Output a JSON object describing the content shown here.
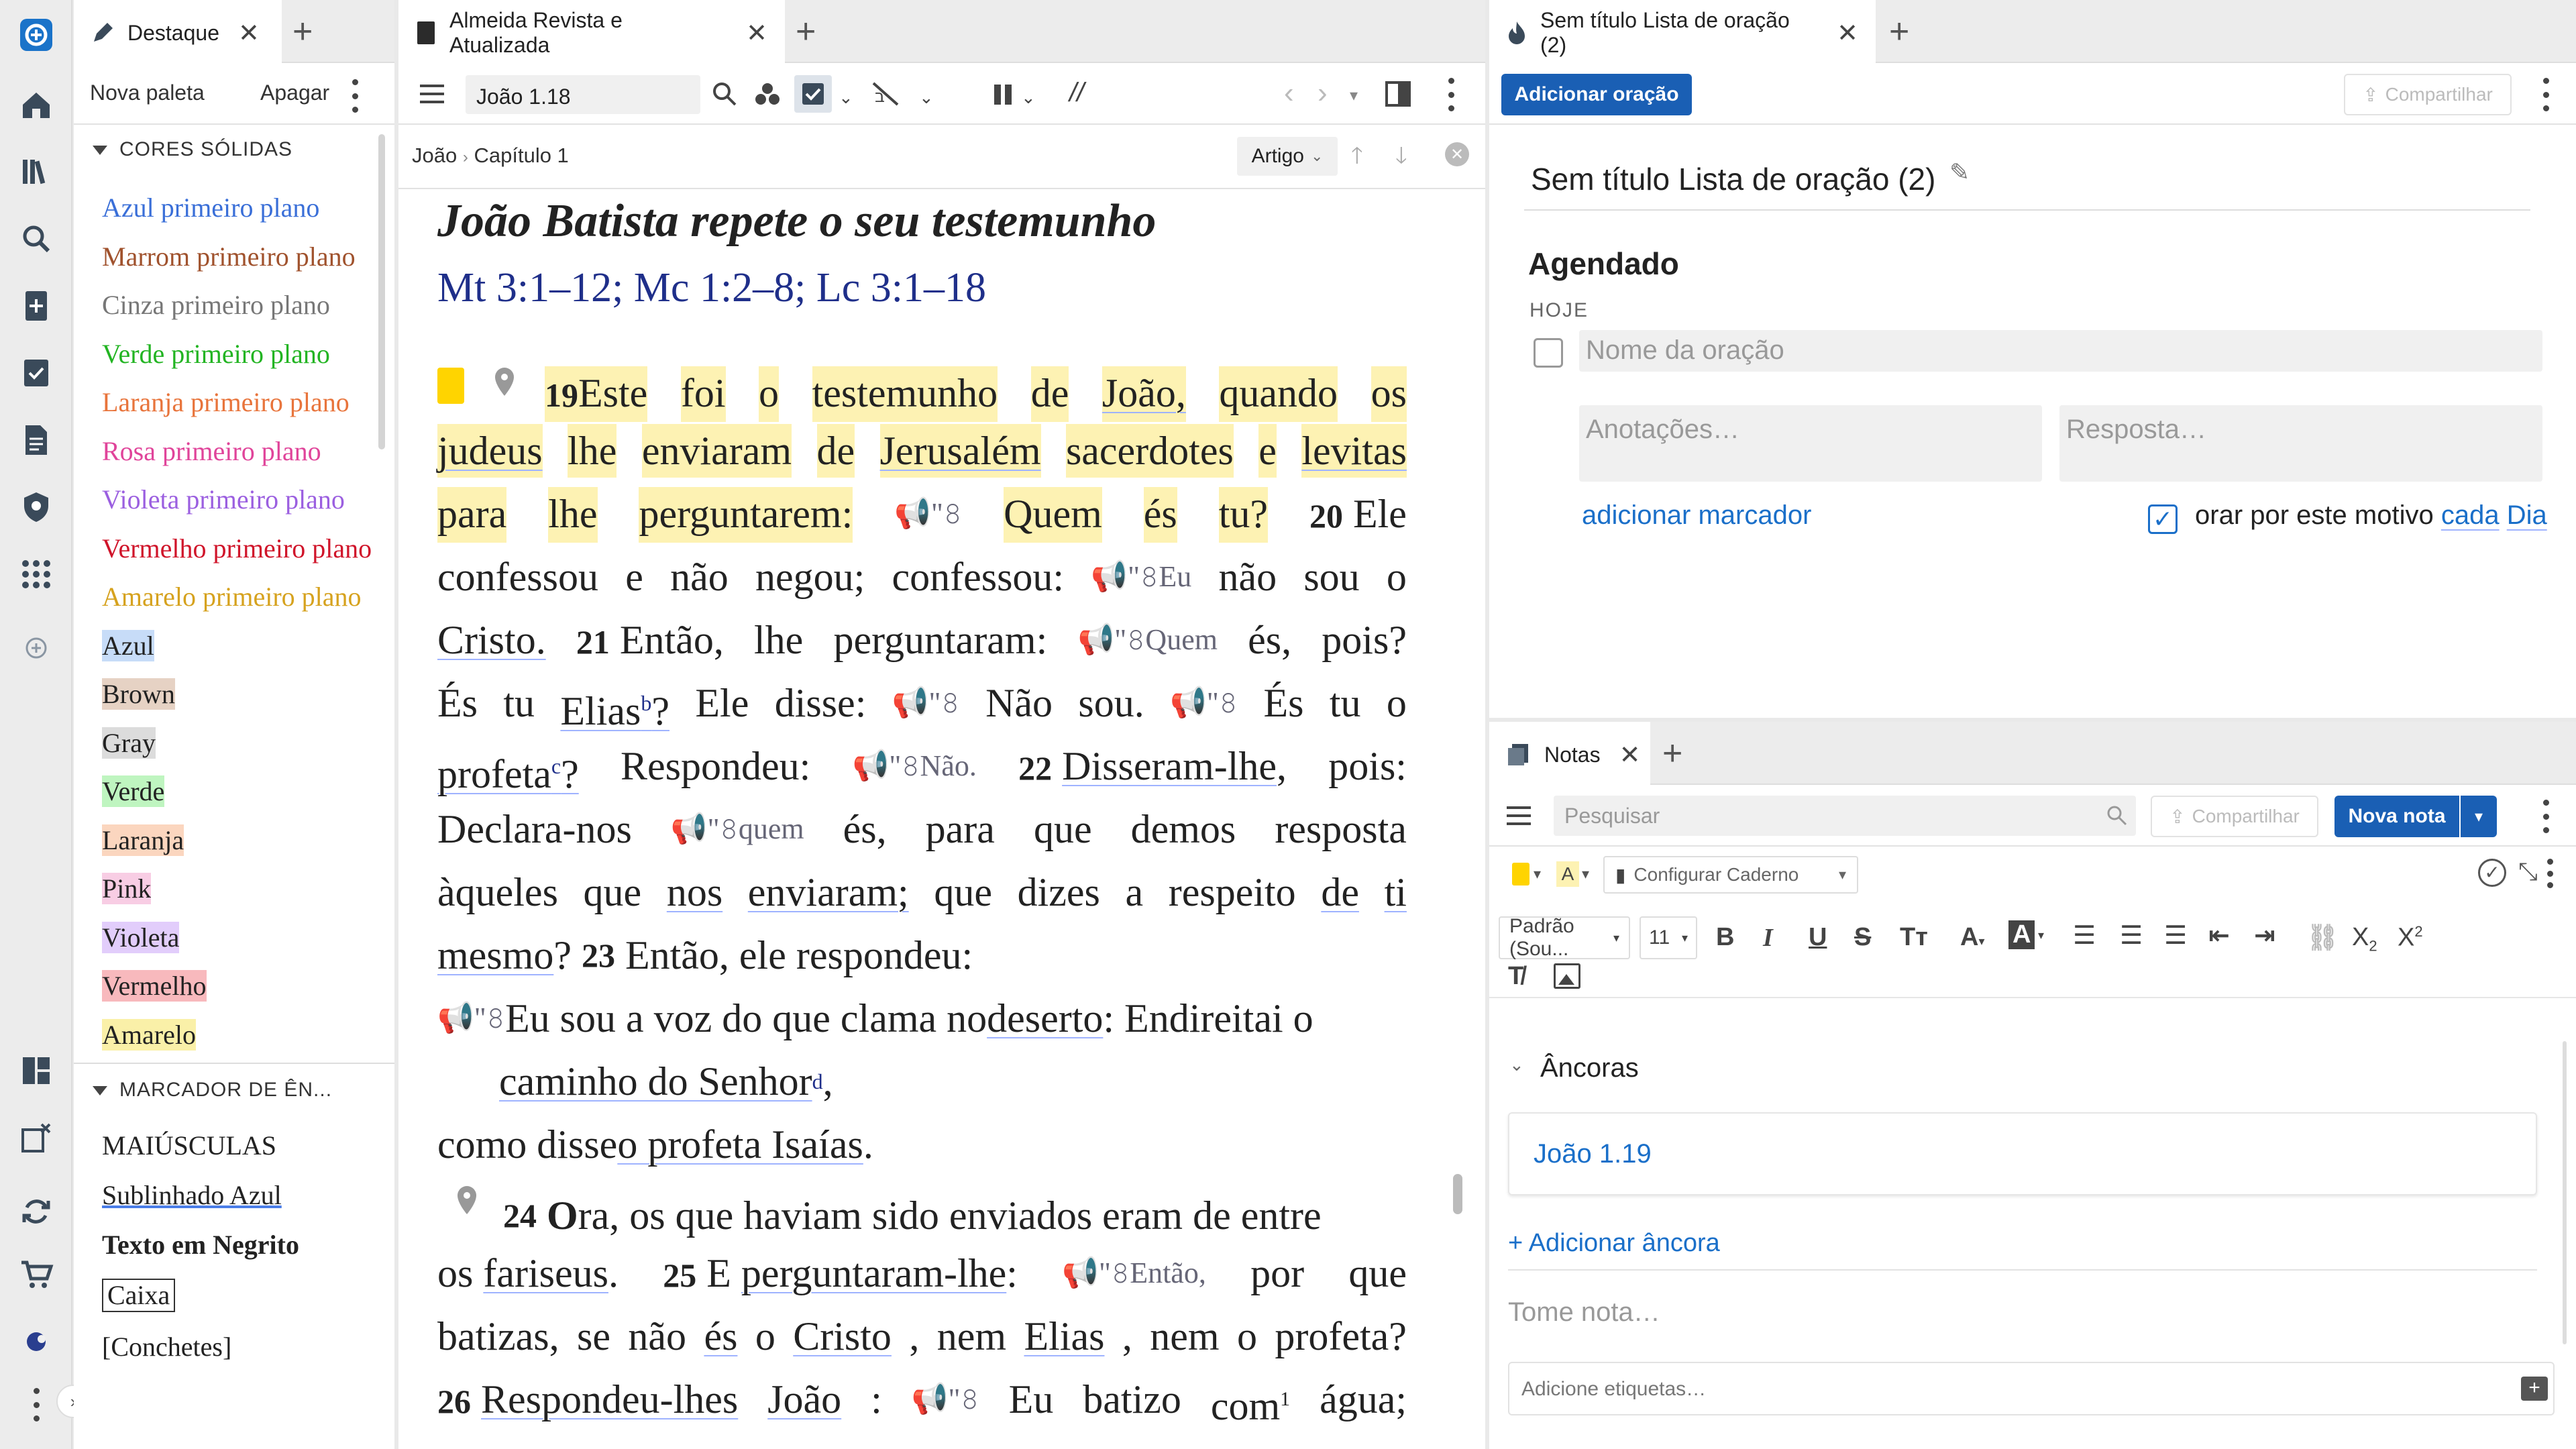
{
  "colors": {
    "accent": "#1a5fb4",
    "link": "#1a6fc9",
    "highlight": "#fdf2b3"
  },
  "rail": {
    "icons": [
      "logo-icon",
      "home-icon",
      "library-icon",
      "search-icon",
      "add-document-icon",
      "checklist-icon",
      "document-icon",
      "shield-icon",
      "apps-grid-icon",
      "add-circle-icon",
      "layout-icon",
      "windows-icon",
      "sync-icon",
      "cart-icon",
      "portfolio-icon",
      "more-icon",
      "expand-icon"
    ]
  },
  "left": {
    "tab_title": "Destaque",
    "new_palette": "Nova paleta",
    "delete": "Apagar",
    "solid_section": "CORES SÓLIDAS",
    "solid_items": [
      {
        "label": "Azul primeiro plano",
        "color": "#3a6fd8",
        "bg": ""
      },
      {
        "label": "Marrom primeiro plano",
        "color": "#a0522d",
        "bg": ""
      },
      {
        "label": "Cinza primeiro plano",
        "color": "#777777",
        "bg": ""
      },
      {
        "label": "Verde primeiro plano",
        "color": "#22b422",
        "bg": ""
      },
      {
        "label": "Laranja primeiro plano",
        "color": "#e8743b",
        "bg": ""
      },
      {
        "label": "Rosa primeiro plano",
        "color": "#e0449a",
        "bg": ""
      },
      {
        "label": "Violeta primeiro plano",
        "color": "#9b5fe0",
        "bg": ""
      },
      {
        "label": "Vermelho primeiro plano",
        "color": "#d0142a",
        "bg": ""
      },
      {
        "label": "Amarelo primeiro plano",
        "color": "#d6a21e",
        "bg": ""
      },
      {
        "label": "Azul",
        "color": "#222",
        "bg": "#c7dcf8"
      },
      {
        "label": "Brown",
        "color": "#222",
        "bg": "#e6d2c4"
      },
      {
        "label": "Gray",
        "color": "#222",
        "bg": "#dcdcdc"
      },
      {
        "label": "Verde",
        "color": "#222",
        "bg": "#bff5c0"
      },
      {
        "label": "Laranja",
        "color": "#222",
        "bg": "#fbd6bf"
      },
      {
        "label": "Pink",
        "color": "#222",
        "bg": "#f8cde4"
      },
      {
        "label": "Violeta",
        "color": "#222",
        "bg": "#e2cdfb"
      },
      {
        "label": "Vermelho",
        "color": "#222",
        "bg": "#f8b9bd"
      },
      {
        "label": "Amarelo",
        "color": "#222",
        "bg": "#faf0a8"
      }
    ],
    "marker_section": "MARCADOR DE ÊN...",
    "marker_items": [
      "MAIÚSCULAS",
      "Sublinhado Azul",
      "Texto em Negrito",
      "Caixa",
      "[Conchetes]"
    ]
  },
  "bible": {
    "tab_title": "Almeida Revista e Atualizada",
    "reference": "João 1.18",
    "breadcrumb": [
      "João",
      "Capítulo 1"
    ],
    "view_mode": "Artigo",
    "heading": "João Batista repete o seu testemunho",
    "crossrefs": "Mt 3:1–12; Mc 1:2–8; Lc 3:1–18",
    "speaker_icon": "📢\"𝟾"
  },
  "prayer": {
    "tab_title": "Sem título Lista de oração (2)",
    "add_button": "Adicionar oração",
    "share": "Compartilhar",
    "list_title": "Sem título Lista de oração (2)",
    "section": "Agendado",
    "today": "HOJE",
    "name_placeholder": "Nome da oração",
    "notes_placeholder": "Anotações…",
    "answer_placeholder": "Resposta…",
    "add_marker": "adicionar marcador",
    "pray_for": "orar por este motivo",
    "each": "cada",
    "day": "Dia"
  },
  "notes": {
    "tab_title": "Notas",
    "search_placeholder": "Pesquisar",
    "share": "Compartilhar",
    "new_note": "Nova nota",
    "notebook": "Configurar Caderno",
    "font": "Padrão (Sou...",
    "size": "11",
    "anchors_title": "Âncoras",
    "anchor": "João 1.19",
    "add_anchor": "+ Adicionar âncora",
    "note_placeholder": "Tome nota…",
    "tags_placeholder": "Adicione etiquetas…"
  }
}
